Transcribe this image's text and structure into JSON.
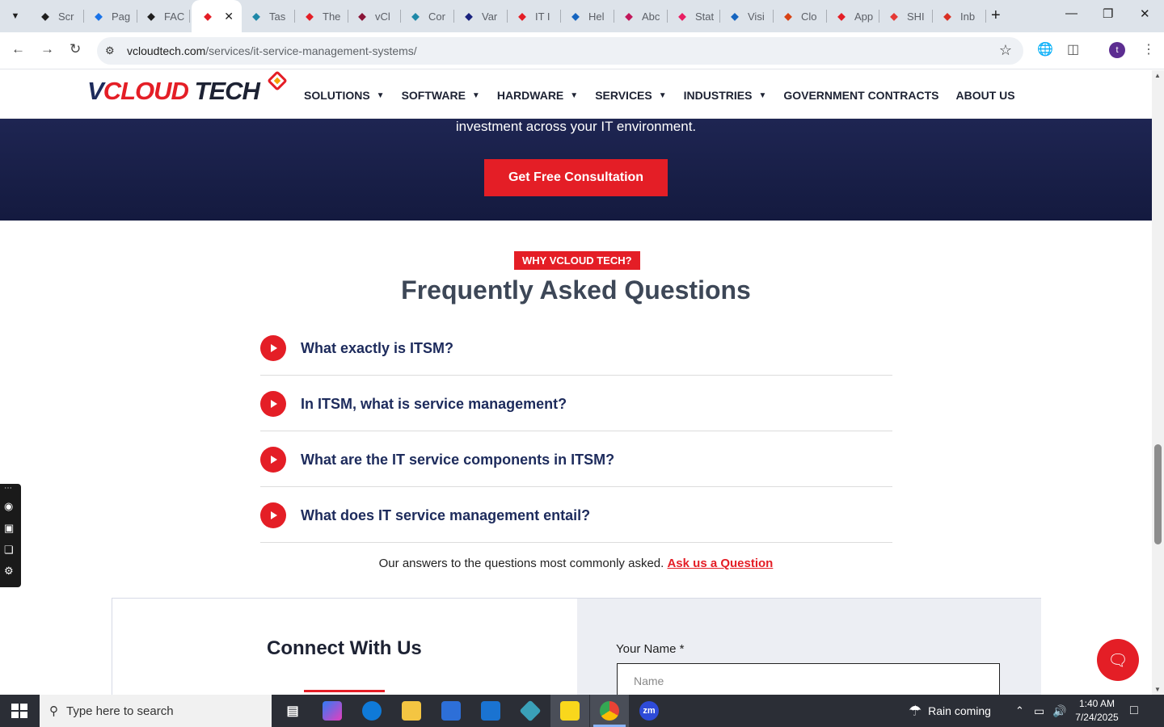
{
  "browser": {
    "tabs": [
      {
        "label": "Scr",
        "icon": "chatgpt-icon",
        "color": "#1f1f1f"
      },
      {
        "label": "Pag",
        "icon": "pagespeed-icon",
        "color": "#1a73e8"
      },
      {
        "label": "FAC",
        "icon": "chatgpt-icon",
        "color": "#1f1f1f"
      },
      {
        "label": "",
        "icon": "vcloud-icon",
        "color": "#e41e26"
      },
      {
        "label": "Tas",
        "icon": "hexagon-icon",
        "color": "#1e88a8"
      },
      {
        "label": "The",
        "icon": "vcloud-icon",
        "color": "#e41e26"
      },
      {
        "label": "vCl",
        "icon": "v-logo-icon",
        "color": "#8a1538"
      },
      {
        "label": "Cor",
        "icon": "hexagon-icon",
        "color": "#1e88a8"
      },
      {
        "label": "Var",
        "icon": "cross-icon",
        "color": "#1a237e"
      },
      {
        "label": "IT I",
        "icon": "vcloud-icon",
        "color": "#e41e26"
      },
      {
        "label": "Hel",
        "icon": "scale-icon",
        "color": "#1565c0"
      },
      {
        "label": "Abc",
        "icon": "feather-icon",
        "color": "#c2185b"
      },
      {
        "label": "Stat",
        "icon": "pen-icon",
        "color": "#e91e63"
      },
      {
        "label": "Visi",
        "icon": "pulse-icon",
        "color": "#1565c0"
      },
      {
        "label": "Clo",
        "icon": "slash-icon",
        "color": "#d84315"
      },
      {
        "label": "App",
        "icon": "vcloud-icon",
        "color": "#e41e26"
      },
      {
        "label": "SHI",
        "icon": "ring-icon",
        "color": "#e53935"
      },
      {
        "label": "Inb",
        "icon": "gmail-icon",
        "color": "#d93025"
      }
    ],
    "url_host": "vcloudtech.com",
    "url_path": "/services/it-service-management-systems/",
    "profile_initial": "t"
  },
  "site": {
    "logo": {
      "v": "V",
      "cloud": "CLOUD",
      "tech": " TECH"
    },
    "menu": [
      {
        "label": "SOLUTIONS",
        "dropdown": true
      },
      {
        "label": "SOFTWARE",
        "dropdown": true
      },
      {
        "label": "HARDWARE",
        "dropdown": true
      },
      {
        "label": "SERVICES",
        "dropdown": true
      },
      {
        "label": "INDUSTRIES",
        "dropdown": true
      },
      {
        "label": "GOVERNMENT CONTRACTS",
        "dropdown": false
      },
      {
        "label": "ABOUT US",
        "dropdown": false
      }
    ],
    "hero_text": "investment across your IT environment.",
    "cta_label": "Get Free Consultation",
    "faq": {
      "badge": "WHY VCLOUD TECH?",
      "title": "Frequently Asked Questions",
      "questions": [
        "What exactly is ITSM?",
        "In ITSM, what is service management?",
        "What are the IT service components in ITSM?",
        "What does IT service management entail?"
      ],
      "note": "Our answers to the questions most commonly asked.",
      "ask_link": "Ask us a Question"
    },
    "connect": {
      "title": "Connect With Us",
      "name_label": "Your Name *",
      "name_placeholder": "Name"
    },
    "colors": {
      "brand_red": "#e41e26",
      "navy": "#1d2b5c"
    }
  },
  "taskbar": {
    "search_placeholder": "Type here to search",
    "weather": "Rain coming",
    "time": "1:40 AM",
    "date": "7/24/2025"
  }
}
